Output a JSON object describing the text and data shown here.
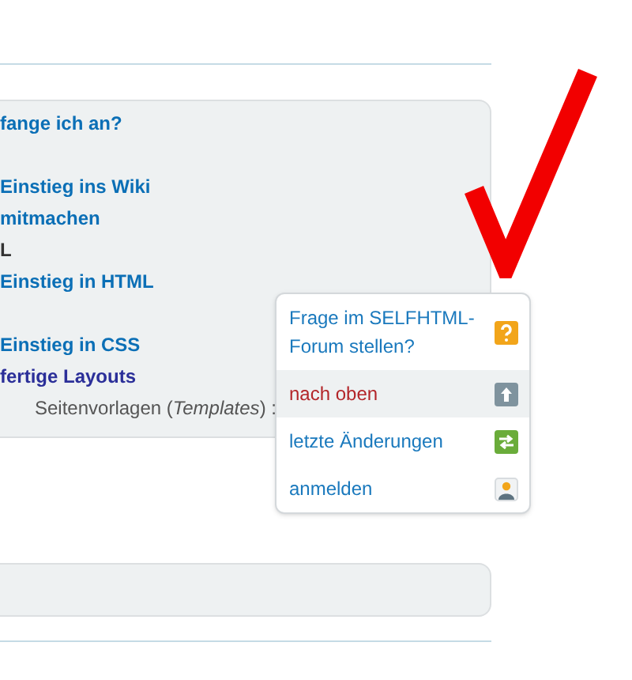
{
  "panel": {
    "groups": [
      {
        "lines": [
          {
            "text": "fange ich an?",
            "kind": "link"
          }
        ]
      },
      {
        "lines": [
          {
            "text": "Einstieg ins Wiki",
            "kind": "link"
          },
          {
            "text": "mitmachen",
            "kind": "link"
          },
          {
            "text": "L",
            "kind": "plain"
          },
          {
            "text": "Einstieg in HTML",
            "kind": "link"
          }
        ]
      },
      {
        "lines": [
          {
            "text": "Einstieg in CSS",
            "kind": "link"
          },
          {
            "text": "fertige Layouts",
            "kind": "visited"
          },
          {
            "text": "Seitenvorlagen (*Templates*) :",
            "kind": "note"
          }
        ]
      }
    ]
  },
  "popup_menu": {
    "items": [
      {
        "label": "Frage im SELFHTML-Forum stellen?",
        "kind": "question",
        "highlighted": false
      },
      {
        "label": "nach oben",
        "kind": "up",
        "highlighted": true
      },
      {
        "label": "letzte Änderungen",
        "kind": "changes",
        "highlighted": false
      },
      {
        "label": "anmelden",
        "kind": "user",
        "highlighted": false
      }
    ]
  }
}
